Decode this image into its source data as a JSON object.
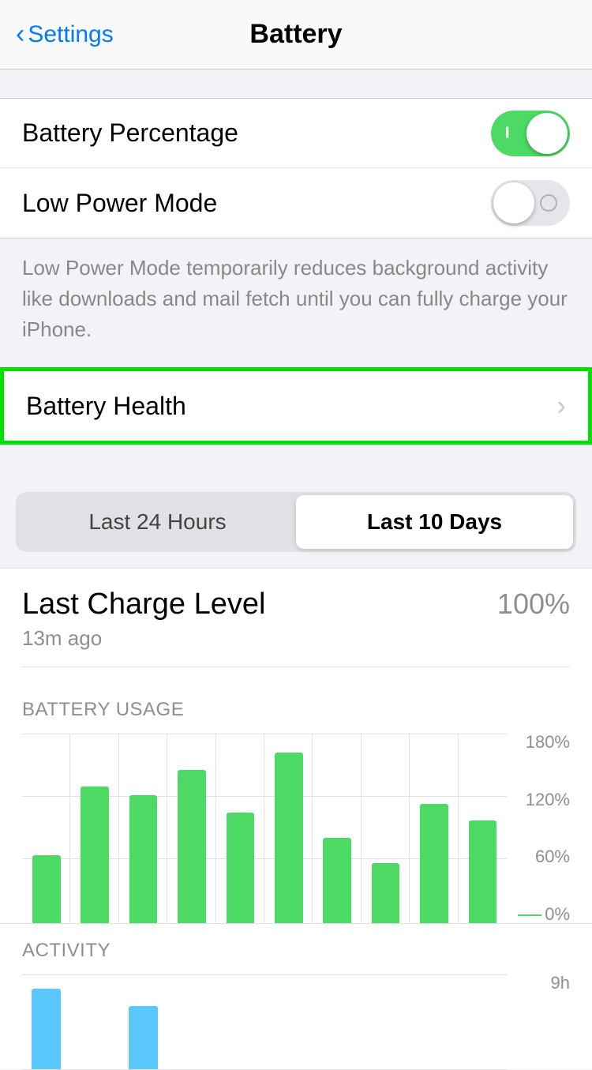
{
  "header": {
    "back_label": "Settings",
    "title": "Battery"
  },
  "rows": {
    "battery_percentage": "Battery Percentage",
    "low_power_mode": "Low Power Mode",
    "battery_health": "Battery Health"
  },
  "toggles": {
    "battery_percentage_on": true,
    "low_power_mode_on": false
  },
  "description": "Low Power Mode temporarily reduces background activity like downloads and mail fetch until you can fully charge your iPhone.",
  "tabs": {
    "option1": "Last 24 Hours",
    "option2": "Last 10 Days",
    "active": "option2"
  },
  "charge": {
    "title": "Last Charge Level",
    "time_ago": "13m ago",
    "percent": "100%"
  },
  "battery_usage": {
    "section_label": "BATTERY USAGE",
    "y_labels": [
      "180%",
      "120%",
      "60%",
      "0%"
    ],
    "bars": [
      40,
      80,
      75,
      90,
      65,
      100,
      50,
      35,
      70,
      60
    ]
  },
  "activity": {
    "section_label": "ACTIVITY",
    "y_label": "9h",
    "bars": [
      70,
      0,
      55,
      0,
      0,
      0,
      0,
      0,
      0,
      0
    ]
  }
}
